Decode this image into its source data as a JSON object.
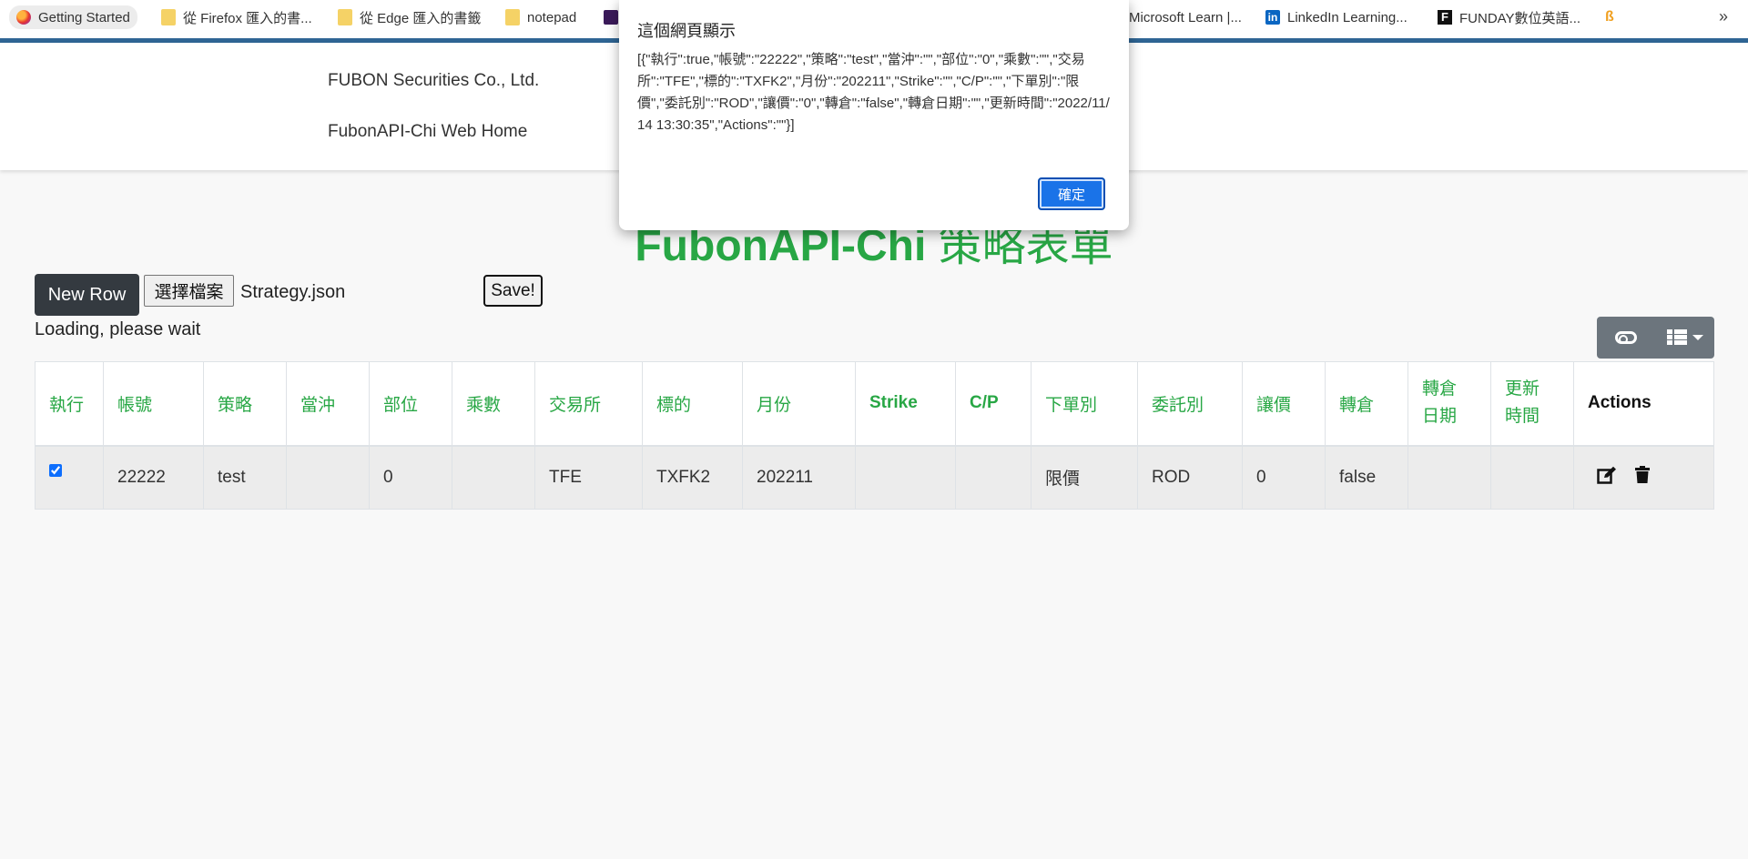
{
  "bookmarks": [
    {
      "label": "Getting Started",
      "icon": "firefox-icon"
    },
    {
      "label": "從 Firefox 匯入的書...",
      "icon": "folder-icon"
    },
    {
      "label": "從 Edge 匯入的書籤",
      "icon": "folder-icon"
    },
    {
      "label": "notepad",
      "icon": "folder-icon"
    },
    {
      "label": "",
      "icon": "media-icon"
    },
    {
      "label": "Microsoft Learn |...",
      "icon": "microsoft-icon"
    },
    {
      "label": "LinkedIn Learning...",
      "icon": "linkedin-icon"
    },
    {
      "label": "FUNDAY數位英語...",
      "icon": "funday-icon"
    },
    {
      "label": "",
      "icon": "bookmark-icon"
    }
  ],
  "bookmarks_overflow": "»",
  "header": {
    "company": "FUBON Securities Co., Ltd.",
    "home_link": "FubonAPI-Chi Web Home"
  },
  "page_title": {
    "latin": "FubonAPI-Chi",
    "zh": "策略表單"
  },
  "controls": {
    "new_row": "New Row",
    "choose_file": "選擇檔案",
    "file_name": "Strategy.json",
    "save": "Save!",
    "loading": "Loading, please wait"
  },
  "table": {
    "columns": [
      "執行",
      "帳號",
      "策略",
      "當沖",
      "部位",
      "乘數",
      "交易所",
      "標的",
      "月份",
      "Strike",
      "C/P",
      "下單別",
      "委託別",
      "讓價",
      "轉倉",
      "轉倉\n日期",
      "更新\n時間",
      "Actions"
    ],
    "rows": [
      {
        "執行": true,
        "帳號": "22222",
        "策略": "test",
        "當沖": "",
        "部位": "0",
        "乘數": "",
        "交易所": "TFE",
        "標的": "TXFK2",
        "月份": "202211",
        "Strike": "",
        "C/P": "",
        "下單別": "限價",
        "委託別": "ROD",
        "讓價": "0",
        "轉倉": "false",
        "轉倉日期": "",
        "更新時間": ""
      }
    ]
  },
  "dialog": {
    "title": "這個網頁顯示",
    "message": "[{\"執行\":true,\"帳號\":\"22222\",\"策略\":\"test\",\"當沖\":\"\",\"部位\":\"0\",\"乘數\":\"\",\"交易所\":\"TFE\",\"標的\":\"TXFK2\",\"月份\":\"202211\",\"Strike\":\"\",\"C/P\":\"\",\"下單別\":\"限價\",\"委託別\":\"ROD\",\"讓價\":\"0\",\"轉倉\":\"false\",\"轉倉日期\":\"\",\"更新時間\":\"2022/11/14 13:30:35\",\"Actions\":\"\"}]",
    "ok": "確定"
  },
  "colors": {
    "accent_green": "#28a745",
    "dark_button": "#343a40",
    "dialog_button": "#1a73e8",
    "bookmark_bar_line": "#2f6594"
  }
}
